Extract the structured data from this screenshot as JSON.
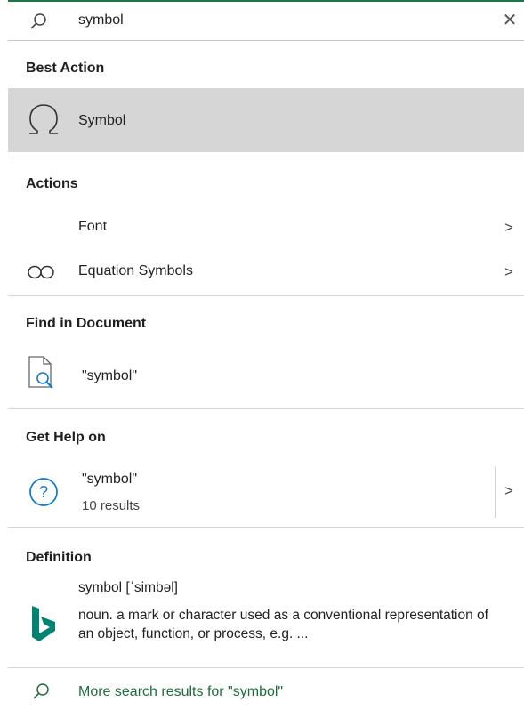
{
  "search": {
    "query": "symbol",
    "clear_icon": "close-icon",
    "search_icon": "search-icon"
  },
  "sections": {
    "best_action": "Best Action",
    "actions": "Actions",
    "find": "Find in Document",
    "help": "Get Help on",
    "definition": "Definition"
  },
  "best_action": {
    "label": "Symbol",
    "icon": "omega-icon"
  },
  "actions": [
    {
      "label": "Font",
      "icon": "",
      "has_submenu": true,
      "chevron": ">"
    },
    {
      "label": "Equation Symbols",
      "icon": "infinity-icon",
      "has_submenu": true,
      "chevron": ">"
    }
  ],
  "find": {
    "label": "\"symbol\"",
    "icon": "document-search-icon"
  },
  "help": {
    "label": "\"symbol\"",
    "subtext": "10 results",
    "icon": "help-icon",
    "chevron": ">"
  },
  "definition": {
    "word": "symbol [ˈsimbəl]",
    "text": "noun. a mark or character used as a conventional representation of an object, function, or process, e.g. ...",
    "icon": "bing-icon"
  },
  "more": {
    "label": "More search results for \"symbol\"",
    "icon": "search-icon"
  },
  "colors": {
    "accent": "#217346",
    "selected_bg": "#d6d6d6",
    "help_blue": "#0f78d4",
    "bing_teal": "#008373",
    "link_green": "#1e6e3c"
  }
}
